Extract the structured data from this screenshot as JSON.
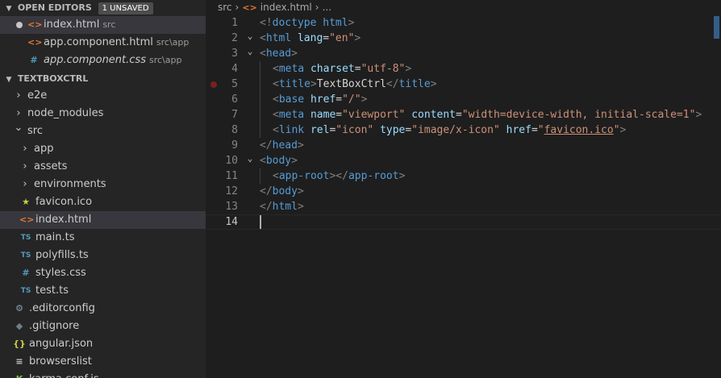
{
  "sidebar": {
    "open_editors": {
      "title": "OPEN EDITORS",
      "badge": "1 UNSAVED",
      "items": [
        {
          "name": "index.html",
          "desc": "src",
          "icon": "html-icon",
          "selected": true,
          "unsaved": true
        },
        {
          "name": "app.component.html",
          "desc": "src\\app",
          "icon": "html-icon"
        },
        {
          "name": "app.component.css",
          "desc": "src\\app",
          "icon": "css-icon",
          "italic": true
        }
      ]
    },
    "project": {
      "title": "TEXTBOXCTRL",
      "items": [
        {
          "name": "e2e",
          "type": "folder",
          "expanded": false,
          "depth": 0
        },
        {
          "name": "node_modules",
          "type": "folder",
          "expanded": false,
          "depth": 0
        },
        {
          "name": "src",
          "type": "folder",
          "expanded": true,
          "depth": 0
        },
        {
          "name": "app",
          "type": "folder",
          "expanded": false,
          "depth": 1
        },
        {
          "name": "assets",
          "type": "folder",
          "expanded": false,
          "depth": 1
        },
        {
          "name": "environments",
          "type": "folder",
          "expanded": false,
          "depth": 1
        },
        {
          "name": "favicon.ico",
          "type": "file",
          "icon": "star-icon",
          "depth": 1
        },
        {
          "name": "index.html",
          "type": "file",
          "icon": "html-icon",
          "depth": 1,
          "selected": true
        },
        {
          "name": "main.ts",
          "type": "file",
          "icon": "ts-icon",
          "depth": 1
        },
        {
          "name": "polyfills.ts",
          "type": "file",
          "icon": "ts-icon",
          "depth": 1
        },
        {
          "name": "styles.css",
          "type": "file",
          "icon": "css-icon",
          "depth": 1
        },
        {
          "name": "test.ts",
          "type": "file",
          "icon": "ts-icon",
          "depth": 1
        },
        {
          "name": ".editorconfig",
          "type": "file",
          "icon": "gear-icon",
          "depth": 0
        },
        {
          "name": ".gitignore",
          "type": "file",
          "icon": "git-icon",
          "depth": 0
        },
        {
          "name": "angular.json",
          "type": "file",
          "icon": "json-icon",
          "depth": 0
        },
        {
          "name": "browserslist",
          "type": "file",
          "icon": "list-icon",
          "depth": 0
        },
        {
          "name": "karma.conf.js",
          "type": "file",
          "icon": "karma-icon",
          "depth": 0
        }
      ]
    }
  },
  "icons": {
    "html-icon": "<>",
    "css-icon": "#",
    "ts-icon": "TS",
    "star-icon": "★",
    "gear-icon": "⚙",
    "git-icon": "◆",
    "json-icon": "{}",
    "list-icon": "≡",
    "karma-icon": "K"
  },
  "breadcrumb": {
    "parts": [
      "src",
      "index.html",
      "..."
    ]
  },
  "editor": {
    "current_line": 14,
    "breakpoint_line": 5,
    "lines": [
      {
        "n": "1",
        "indent": 0,
        "tokens": [
          [
            "punc",
            "<!"
          ],
          [
            "tag",
            "doctype"
          ],
          [
            "txt",
            " "
          ],
          [
            "tag",
            "html"
          ],
          [
            "punc",
            ">"
          ]
        ]
      },
      {
        "n": "2",
        "indent": 0,
        "fold": true,
        "tokens": [
          [
            "punc",
            "<"
          ],
          [
            "tag",
            "html"
          ],
          [
            "txt",
            " "
          ],
          [
            "attr",
            "lang"
          ],
          [
            "txt",
            "="
          ],
          [
            "str",
            "\"en\""
          ],
          [
            "punc",
            ">"
          ]
        ]
      },
      {
        "n": "3",
        "indent": 0,
        "fold": true,
        "tokens": [
          [
            "punc",
            "<"
          ],
          [
            "tag",
            "head"
          ],
          [
            "punc",
            ">"
          ]
        ]
      },
      {
        "n": "4",
        "indent": 1,
        "tokens": [
          [
            "punc",
            "<"
          ],
          [
            "tag",
            "meta"
          ],
          [
            "txt",
            " "
          ],
          [
            "attr",
            "charset"
          ],
          [
            "txt",
            "="
          ],
          [
            "str",
            "\"utf-8\""
          ],
          [
            "punc",
            ">"
          ]
        ]
      },
      {
        "n": "5",
        "indent": 1,
        "tokens": [
          [
            "punc",
            "<"
          ],
          [
            "tag",
            "title"
          ],
          [
            "punc",
            ">"
          ],
          [
            "txt",
            "TextBoxCtrl"
          ],
          [
            "punc",
            "</"
          ],
          [
            "tag",
            "title"
          ],
          [
            "punc",
            ">"
          ]
        ]
      },
      {
        "n": "6",
        "indent": 1,
        "tokens": [
          [
            "punc",
            "<"
          ],
          [
            "tag",
            "base"
          ],
          [
            "txt",
            " "
          ],
          [
            "attr",
            "href"
          ],
          [
            "txt",
            "="
          ],
          [
            "str",
            "\"/\""
          ],
          [
            "punc",
            ">"
          ]
        ]
      },
      {
        "n": "7",
        "indent": 1,
        "tokens": [
          [
            "punc",
            "<"
          ],
          [
            "tag",
            "meta"
          ],
          [
            "txt",
            " "
          ],
          [
            "attr",
            "name"
          ],
          [
            "txt",
            "="
          ],
          [
            "str",
            "\"viewport\""
          ],
          [
            "txt",
            " "
          ],
          [
            "attr",
            "content"
          ],
          [
            "txt",
            "="
          ],
          [
            "str",
            "\"width=device-width, initial-scale=1\""
          ],
          [
            "punc",
            ">"
          ]
        ]
      },
      {
        "n": "8",
        "indent": 1,
        "tokens": [
          [
            "punc",
            "<"
          ],
          [
            "tag",
            "link"
          ],
          [
            "txt",
            " "
          ],
          [
            "attr",
            "rel"
          ],
          [
            "txt",
            "="
          ],
          [
            "str",
            "\"icon\""
          ],
          [
            "txt",
            " "
          ],
          [
            "attr",
            "type"
          ],
          [
            "txt",
            "="
          ],
          [
            "str",
            "\"image/x-icon\""
          ],
          [
            "txt",
            " "
          ],
          [
            "attr",
            "href"
          ],
          [
            "txt",
            "="
          ],
          [
            "str",
            "\""
          ],
          [
            "strlink",
            "favicon.ico"
          ],
          [
            "str",
            "\""
          ],
          [
            "punc",
            ">"
          ]
        ]
      },
      {
        "n": "9",
        "indent": 0,
        "tokens": [
          [
            "punc",
            "</"
          ],
          [
            "tag",
            "head"
          ],
          [
            "punc",
            ">"
          ]
        ]
      },
      {
        "n": "10",
        "indent": 0,
        "fold": true,
        "tokens": [
          [
            "punc",
            "<"
          ],
          [
            "tag",
            "body"
          ],
          [
            "punc",
            ">"
          ]
        ]
      },
      {
        "n": "11",
        "indent": 1,
        "tokens": [
          [
            "punc",
            "<"
          ],
          [
            "tag",
            "app-root"
          ],
          [
            "punc",
            "></"
          ],
          [
            "tag",
            "app-root"
          ],
          [
            "punc",
            ">"
          ]
        ]
      },
      {
        "n": "12",
        "indent": 0,
        "tokens": [
          [
            "punc",
            "</"
          ],
          [
            "tag",
            "body"
          ],
          [
            "punc",
            ">"
          ]
        ]
      },
      {
        "n": "13",
        "indent": 0,
        "tokens": [
          [
            "punc",
            "</"
          ],
          [
            "tag",
            "html"
          ],
          [
            "punc",
            ">"
          ]
        ]
      },
      {
        "n": "14",
        "indent": 0,
        "tokens": []
      }
    ]
  }
}
